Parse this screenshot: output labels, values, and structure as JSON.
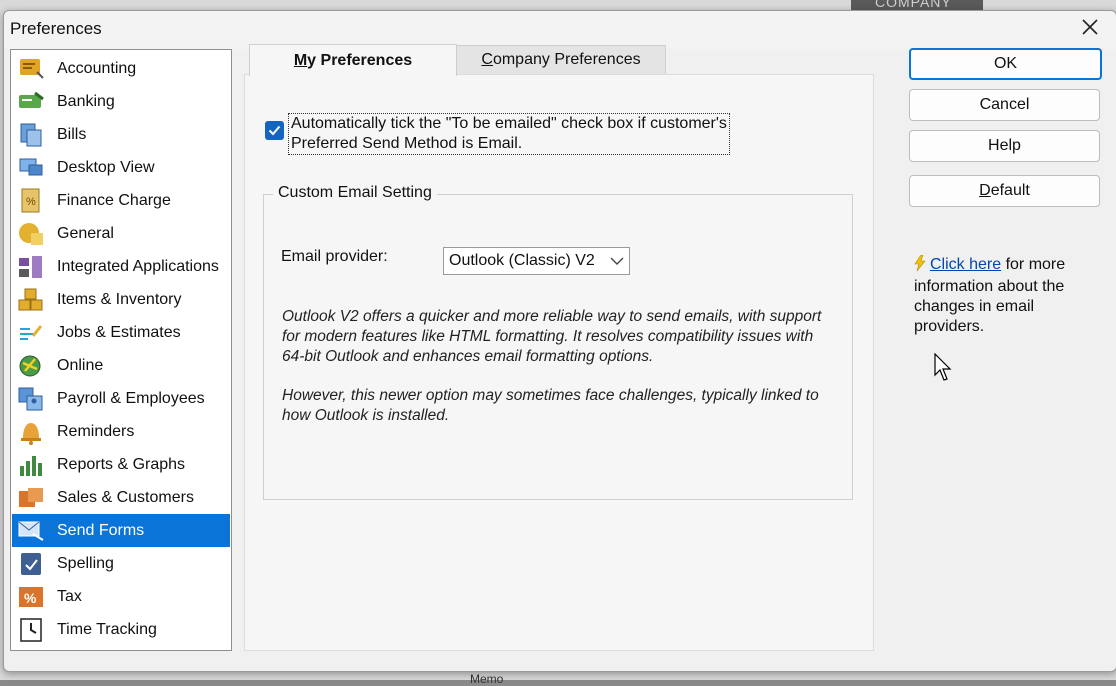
{
  "window": {
    "title": "Preferences"
  },
  "background": {
    "company_label": "COMPANY",
    "memo_label": "Memo"
  },
  "categories": [
    {
      "label": "Accounting",
      "icon": "accounting-icon"
    },
    {
      "label": "Banking",
      "icon": "banking-icon"
    },
    {
      "label": "Bills",
      "icon": "bills-icon"
    },
    {
      "label": "Desktop View",
      "icon": "desktop-view-icon"
    },
    {
      "label": "Finance Charge",
      "icon": "finance-charge-icon"
    },
    {
      "label": "General",
      "icon": "general-icon"
    },
    {
      "label": "Integrated Applications",
      "icon": "integrated-applications-icon"
    },
    {
      "label": "Items & Inventory",
      "icon": "items-inventory-icon"
    },
    {
      "label": "Jobs & Estimates",
      "icon": "jobs-estimates-icon"
    },
    {
      "label": "Online",
      "icon": "online-icon"
    },
    {
      "label": "Payroll & Employees",
      "icon": "payroll-employees-icon"
    },
    {
      "label": "Reminders",
      "icon": "reminders-bell-icon"
    },
    {
      "label": "Reports & Graphs",
      "icon": "reports-graphs-icon"
    },
    {
      "label": "Sales & Customers",
      "icon": "sales-customers-icon"
    },
    {
      "label": "Send Forms",
      "icon": "send-forms-icon",
      "selected": true
    },
    {
      "label": "Spelling",
      "icon": "spelling-icon"
    },
    {
      "label": "Tax",
      "icon": "tax-icon"
    },
    {
      "label": "Time Tracking",
      "icon": "time-tracking-icon"
    }
  ],
  "tabs": {
    "my_prefix": "M",
    "my_rest": "y Preferences",
    "company_prefix": "C",
    "company_rest": "ompany Preferences",
    "active": "My Preferences"
  },
  "my_preferences": {
    "checkbox_checked": true,
    "checkbox_line1": "Automatically tick the \"To be emailed\" check box if customer's",
    "checkbox_line2": "Preferred Send Method is Email.",
    "group_title": "Custom Email Setting",
    "provider_label": "Email provider:",
    "provider_value": "Outlook (Classic) V2",
    "description1": "Outlook V2 offers a quicker and more reliable way to send emails, with support for modern features like HTML formatting. It resolves compatibility issues with 64-bit Outlook and enhances email formatting options.",
    "description2": "However, this newer option may sometimes face challenges, typically linked to how Outlook is installed."
  },
  "buttons": {
    "ok": "OK",
    "cancel": "Cancel",
    "help": "Help",
    "default_prefix": "D",
    "default_rest": "efault"
  },
  "info": {
    "link_text": "Click here",
    "text": " for more information about the changes in email providers."
  },
  "colors": {
    "selection": "#0a74d8",
    "checkbox": "#1565c0",
    "link": "#0645ad"
  }
}
